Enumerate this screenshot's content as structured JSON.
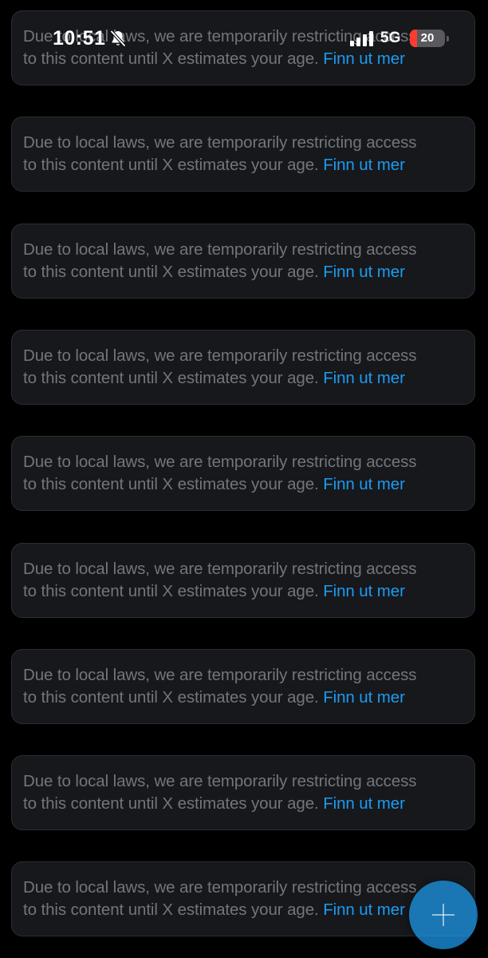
{
  "status_bar": {
    "time": "10:51",
    "network": "5G",
    "battery_level": "20",
    "battery_fraction": 0.2,
    "bell_icon": "bell-slash-icon",
    "signal_icon": "cellular-signal-icon"
  },
  "notices": [
    {
      "line1": "Due to local laws, we are temporarily restricting access",
      "line2": "to this content until X estimates your age.",
      "link": "Finn ut mer"
    },
    {
      "line1": "Due to local laws, we are temporarily restricting access",
      "line2": "to this content until X estimates your age.",
      "link": "Finn ut mer"
    },
    {
      "line1": "Due to local laws, we are temporarily restricting access",
      "line2": "to this content until X estimates your age.",
      "link": "Finn ut mer"
    },
    {
      "line1": "Due to local laws, we are temporarily restricting access",
      "line2": "to this content until X estimates your age.",
      "link": "Finn ut mer"
    },
    {
      "line1": "Due to local laws, we are temporarily restricting access",
      "line2": "to this content until X estimates your age.",
      "link": "Finn ut mer"
    },
    {
      "line1": "Due to local laws, we are temporarily restricting access",
      "line2": "to this content until X estimates your age.",
      "link": "Finn ut mer"
    },
    {
      "line1": "Due to local laws, we are temporarily restricting access",
      "line2": "to this content until X estimates your age.",
      "link": "Finn ut mer"
    },
    {
      "line1": "Due to local laws, we are temporarily restricting access",
      "line2": "to this content until X estimates your age.",
      "link": "Finn ut mer"
    },
    {
      "line1": "Due to local laws, we are temporarily restricting access",
      "line2": "to this content until X estimates your age.",
      "link": "Finn ut mer"
    }
  ],
  "fab": {
    "icon": "plus-icon"
  },
  "colors": {
    "background": "#000000",
    "card": "#16181c",
    "text_muted": "#71767b",
    "link": "#1d9bf0",
    "battery_low": "#ff3b30"
  }
}
